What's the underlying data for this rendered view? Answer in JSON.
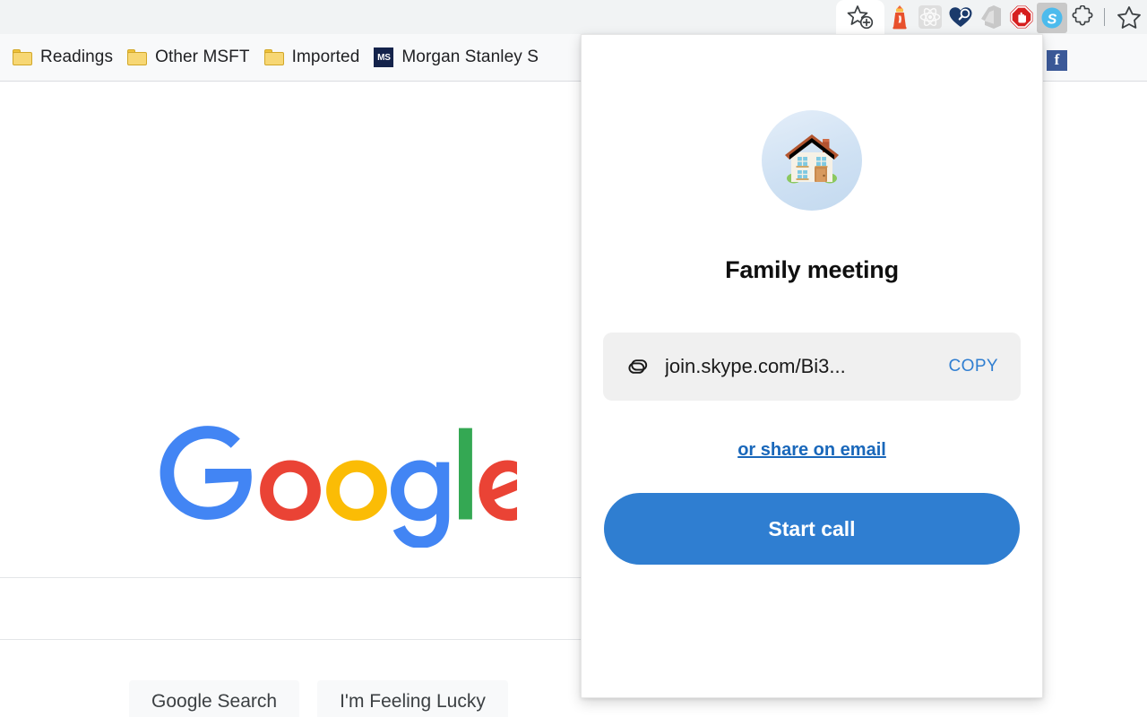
{
  "browser": {
    "extensions": [
      {
        "name": "add-bookmark-star-icon",
        "label": "Add bookmark"
      },
      {
        "name": "lighthouse-icon",
        "label": "Lighthouse"
      },
      {
        "name": "react-devtools-icon",
        "label": "React Developer Tools"
      },
      {
        "name": "heart-search-icon",
        "label": "Heart search"
      },
      {
        "name": "office-icon",
        "label": "Office"
      },
      {
        "name": "adblock-stop-icon",
        "label": "AdBlock"
      },
      {
        "name": "skype-icon",
        "label": "Skype"
      },
      {
        "name": "extensions-puzzle-icon",
        "label": "Extensions"
      },
      {
        "name": "bookmark-star-icon",
        "label": "Bookmark this tab"
      }
    ],
    "bookmarks": [
      {
        "label": "Readings",
        "icon": "folder-icon"
      },
      {
        "label": "Other MSFT",
        "icon": "folder-icon"
      },
      {
        "label": "Imported",
        "icon": "folder-icon"
      },
      {
        "label": "Morgan Stanley S",
        "icon": "ms-favicon",
        "favicon_text": "MS"
      }
    ],
    "bookmark_right": {
      "label": "Facebook",
      "favicon_text": "f"
    }
  },
  "google_page": {
    "logo_alt": "Google",
    "logo_letters": [
      "G",
      "o",
      "o",
      "g",
      "l",
      "e"
    ],
    "search_value": "",
    "buttons": [
      {
        "label": "Google Search"
      },
      {
        "label": "I'm Feeling Lucky"
      }
    ]
  },
  "skype_popup": {
    "avatar_icon": "house-emoji",
    "title": "Family meeting",
    "link_icon": "chain-link-icon",
    "link_text": "join.skype.com/Bi3...",
    "copy_label": "COPY",
    "share_label": "or share on email",
    "start_call_label": "Start call"
  },
  "colors": {
    "skype_blue": "#2f7ed1",
    "link_blue": "#1967ba",
    "google_blue": "#4285f4",
    "google_red": "#ea4335",
    "google_yellow": "#fbbc05",
    "google_green": "#34a853",
    "chrome_toolbar": "#f1f3f4",
    "bookmarks_bar": "#f8f9fa"
  }
}
